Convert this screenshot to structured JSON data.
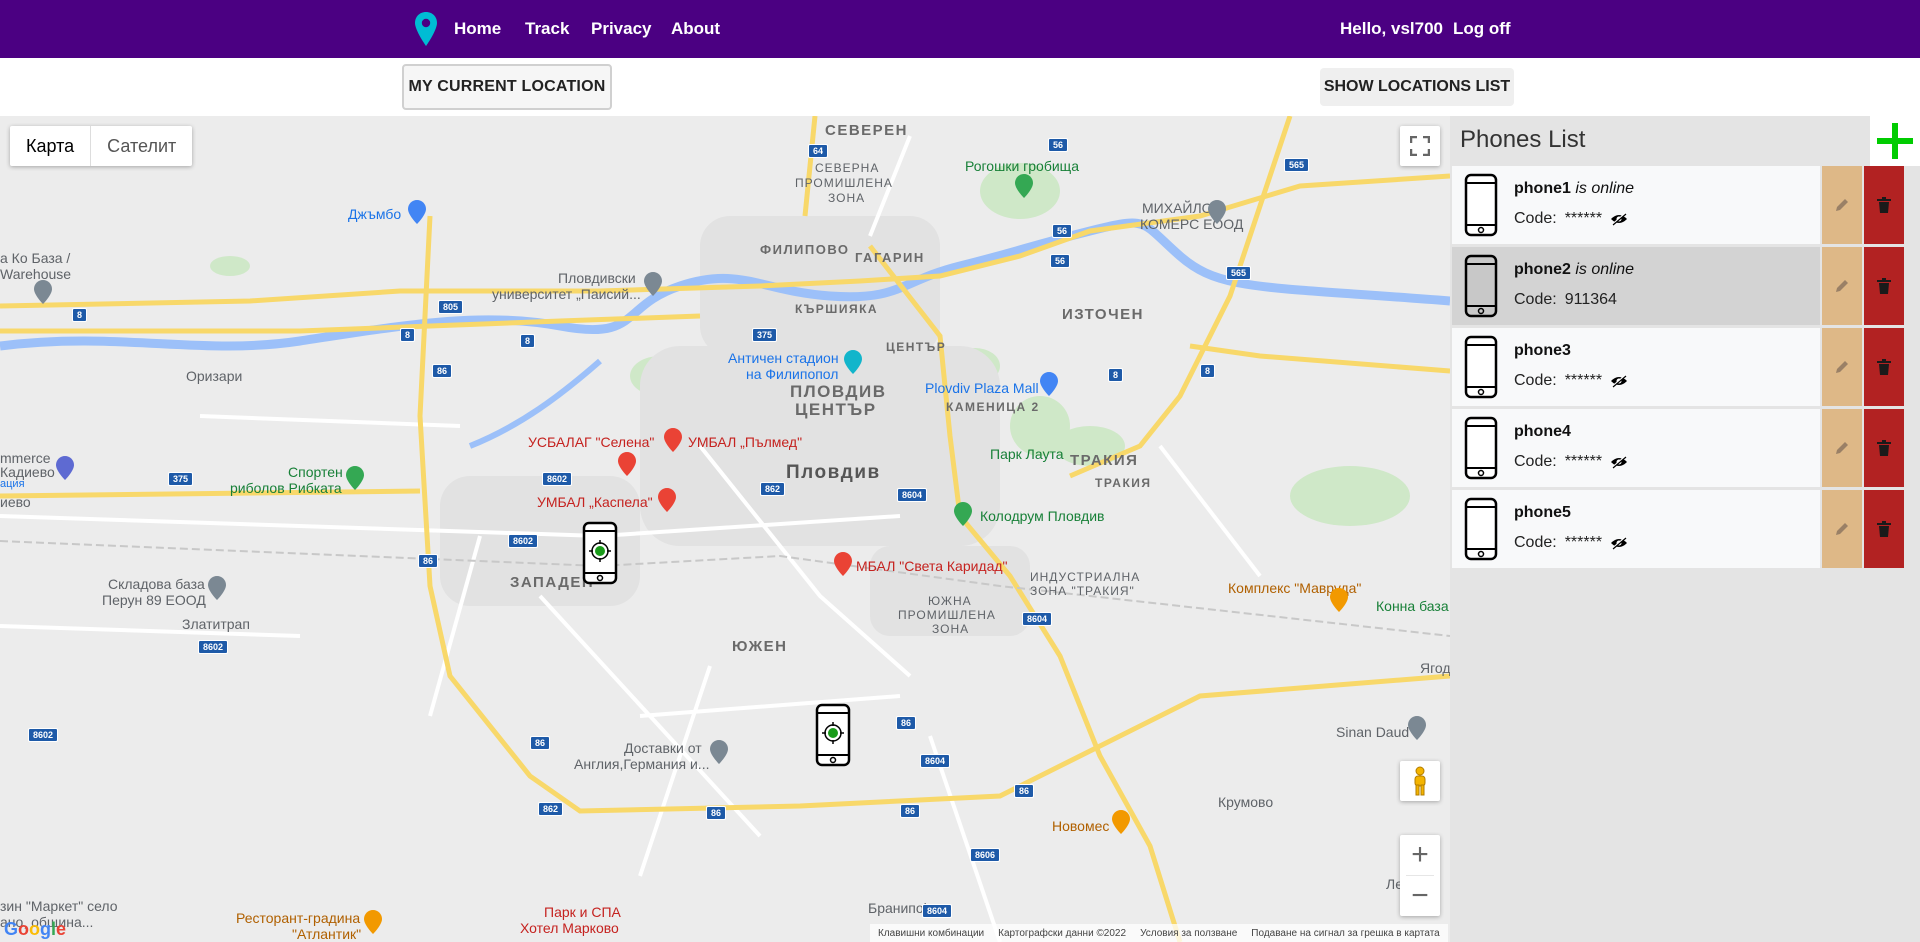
{
  "nav": {
    "links": [
      "Home",
      "Track",
      "Privacy",
      "About"
    ],
    "greeting": "Hello, vsl700",
    "logoff": "Log off"
  },
  "toolbar": {
    "current_location": "MY CURRENT LOCATION",
    "show_list": "SHOW LOCATIONS LIST"
  },
  "map": {
    "type_map": "Карта",
    "type_satellite": "Сателит",
    "footer": [
      "Клавишни комбинации",
      "Картографски данни ©2022",
      "Условия за ползване",
      "Подаване на сигнал за грешка в картата"
    ],
    "logo": "Google",
    "labels": {
      "severen": "СЕВЕРЕН",
      "severna": "СЕВЕРНА",
      "promishlena": "ПРОМИШЛЕНА",
      "zona": "ЗОНА",
      "filipovo": "ФИЛИПОВО",
      "gagarin": "ГАГАРИН",
      "karshiyaka": "КЪРШИЯКА",
      "iztochen": "ИЗТОЧЕН",
      "tsentar": "ЦЕНТЪР",
      "plovdiv_tsentar_1": "ПЛОВДИВ",
      "plovdiv_tsentar_2": "ЦЕНТЪР",
      "kamenitsa": "КАМЕНИЦА 2",
      "plovdiv": "Пловдив",
      "trakia": "ТРАКИЯ",
      "trakia_small": "ТРАКИЯ",
      "zapaden": "ЗАПАДЕН",
      "yuzhen": "ЮЖЕН",
      "yuzhna_1": "ЮЖНА",
      "yuzhna_2": "ПРОМИШЛЕНА",
      "yuzhna_3": "ЗОНА",
      "industrialna_1": "ИНДУСТРИАЛНА",
      "industrialna_2": "ЗОНА \"ТРАКИЯ\"",
      "rogoshki": "Рогошки гробища",
      "dzhambo": "Джъмбо",
      "mihaylov_1": "МИХАЙЛОВ",
      "mihaylov_2": "КОМЕРС ЕООД",
      "kobaza_1": "а Ко База /",
      "kobaza_2": "Warehouse",
      "univ_1": "Пловдивски",
      "univ_2": "университет „Паисий...",
      "antichen_1": "Античен стадион",
      "antichen_2": "на Филипопол",
      "plaza": "Plovdiv Plaza Mall",
      "oritsari": "Оризари",
      "usbalag": "УСБАЛАГ \"Селена\"",
      "umbal_palmed": "УМБАЛ „Пълмед\"",
      "umbal_kaspela": "УМБАЛ „Каспела\"",
      "park_lauta": "Парк Лаута",
      "kolodrum": "Колодрум Пловдив",
      "mbal": "МБАЛ \"Света Каридад\"",
      "sporten_1": "Спортен",
      "sporten_2": "риболов Рибката",
      "commerce_1": "mmerce",
      "commerce_2": "Кадиево",
      "commerce_3": "ация",
      "kadievo": "иево",
      "skladova_1": "Складова база",
      "skladova_2": "Перун 89 ЕООД",
      "zlatitrap": "Златитрап",
      "mavruda": "Комплекс \"Маврудa\"",
      "konna": "Конна база",
      "yagod": "Ягод",
      "dostavki_1": "Доставки от",
      "dostavki_2": "Англия,Германия и...",
      "sinan": "Sinan Daud",
      "krumovo": "Крумово",
      "novomes": "Новомес",
      "branipole": "Бранипole",
      "park_spa_1": "Парк и СПА",
      "park_spa_2": "Хотел Марково",
      "restorant_1": "Ресторант-градина",
      "restorant_2": "\"Атлантик\"",
      "market_1": "зин \"Маркет\" село",
      "market_2": "ано, община...",
      "le": "Ле"
    },
    "road_numbers": [
      "64",
      "56",
      "565",
      "805",
      "8",
      "8",
      "8",
      "86",
      "375",
      "56",
      "56",
      "565",
      "8",
      "8",
      "8604",
      "8602",
      "8602",
      "86",
      "862",
      "8604",
      "86",
      "8602",
      "8602",
      "86",
      "86",
      "8604",
      "8606",
      "86",
      "375",
      "862",
      "8604",
      "86"
    ]
  },
  "panel": {
    "title": "Phones List",
    "online_text": "is online",
    "code_label": "Code:",
    "phones": [
      {
        "name": "phone1",
        "online": true,
        "code": "******",
        "hidden": true,
        "selected": false
      },
      {
        "name": "phone2",
        "online": true,
        "code": "911364",
        "hidden": false,
        "selected": true
      },
      {
        "name": "phone3",
        "online": false,
        "code": "******",
        "hidden": true,
        "selected": false
      },
      {
        "name": "phone4",
        "online": false,
        "code": "******",
        "hidden": true,
        "selected": false
      },
      {
        "name": "phone5",
        "online": false,
        "code": "******",
        "hidden": true,
        "selected": false
      }
    ]
  },
  "colors": {
    "nav_bg": "#4b0082",
    "edit": "#deb887",
    "delete": "#b22222",
    "add": "#00cc00",
    "marker": "#1a9b1a"
  }
}
